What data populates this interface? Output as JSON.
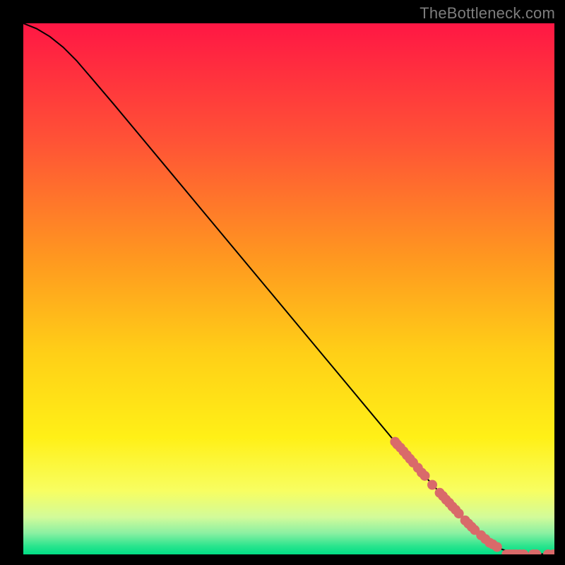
{
  "attribution": "TheBottleneck.com",
  "chart_data": {
    "type": "line",
    "title": "",
    "xlabel": "",
    "ylabel": "",
    "x_range": [
      0,
      1
    ],
    "y_range": [
      0,
      1
    ],
    "background_gradient": {
      "stops": [
        {
          "pos": 0.0,
          "color": "#FF1744"
        },
        {
          "pos": 0.22,
          "color": "#FF5236"
        },
        {
          "pos": 0.45,
          "color": "#FF9A1F"
        },
        {
          "pos": 0.62,
          "color": "#FFCF17"
        },
        {
          "pos": 0.78,
          "color": "#FFF017"
        },
        {
          "pos": 0.88,
          "color": "#F8FE61"
        },
        {
          "pos": 0.93,
          "color": "#D2FB9A"
        },
        {
          "pos": 0.96,
          "color": "#8AF0A2"
        },
        {
          "pos": 0.985,
          "color": "#28E48D"
        },
        {
          "pos": 1.0,
          "color": "#00DE85"
        }
      ]
    },
    "curve": {
      "points": [
        {
          "x": 0.0,
          "y": 1.0
        },
        {
          "x": 0.025,
          "y": 0.99
        },
        {
          "x": 0.05,
          "y": 0.975
        },
        {
          "x": 0.075,
          "y": 0.955
        },
        {
          "x": 0.1,
          "y": 0.93
        },
        {
          "x": 0.13,
          "y": 0.895
        },
        {
          "x": 0.17,
          "y": 0.848
        },
        {
          "x": 0.22,
          "y": 0.788
        },
        {
          "x": 0.28,
          "y": 0.716
        },
        {
          "x": 0.34,
          "y": 0.644
        },
        {
          "x": 0.4,
          "y": 0.572
        },
        {
          "x": 0.46,
          "y": 0.5
        },
        {
          "x": 0.52,
          "y": 0.428
        },
        {
          "x": 0.58,
          "y": 0.356
        },
        {
          "x": 0.64,
          "y": 0.284
        },
        {
          "x": 0.7,
          "y": 0.212
        },
        {
          "x": 0.76,
          "y": 0.143
        },
        {
          "x": 0.8,
          "y": 0.099
        },
        {
          "x": 0.83,
          "y": 0.067
        },
        {
          "x": 0.852,
          "y": 0.045
        },
        {
          "x": 0.87,
          "y": 0.029
        },
        {
          "x": 0.885,
          "y": 0.018
        },
        {
          "x": 0.9,
          "y": 0.01
        },
        {
          "x": 0.915,
          "y": 0.005
        },
        {
          "x": 0.935,
          "y": 0.002
        },
        {
          "x": 0.96,
          "y": 0.001
        },
        {
          "x": 1.0,
          "y": 0.0
        }
      ],
      "stroke": "#000000",
      "stroke_width": 2
    },
    "markers": {
      "color": "#D96A6A",
      "radius": 7,
      "points": [
        {
          "x": 0.7,
          "y": 0.212
        },
        {
          "x": 0.704,
          "y": 0.207
        },
        {
          "x": 0.71,
          "y": 0.201
        },
        {
          "x": 0.716,
          "y": 0.194
        },
        {
          "x": 0.722,
          "y": 0.187
        },
        {
          "x": 0.728,
          "y": 0.18
        },
        {
          "x": 0.734,
          "y": 0.173
        },
        {
          "x": 0.743,
          "y": 0.163
        },
        {
          "x": 0.75,
          "y": 0.154
        },
        {
          "x": 0.756,
          "y": 0.148
        },
        {
          "x": 0.77,
          "y": 0.131
        },
        {
          "x": 0.784,
          "y": 0.116
        },
        {
          "x": 0.79,
          "y": 0.11
        },
        {
          "x": 0.796,
          "y": 0.103
        },
        {
          "x": 0.802,
          "y": 0.097
        },
        {
          "x": 0.808,
          "y": 0.09
        },
        {
          "x": 0.814,
          "y": 0.084
        },
        {
          "x": 0.82,
          "y": 0.077
        },
        {
          "x": 0.832,
          "y": 0.064
        },
        {
          "x": 0.838,
          "y": 0.058
        },
        {
          "x": 0.844,
          "y": 0.052
        },
        {
          "x": 0.85,
          "y": 0.046
        },
        {
          "x": 0.862,
          "y": 0.036
        },
        {
          "x": 0.87,
          "y": 0.029
        },
        {
          "x": 0.878,
          "y": 0.022
        },
        {
          "x": 0.884,
          "y": 0.019
        },
        {
          "x": 0.892,
          "y": 0.014
        },
        {
          "x": 0.91,
          "y": 0.0
        },
        {
          "x": 0.916,
          "y": 0.0
        },
        {
          "x": 0.922,
          "y": 0.0
        },
        {
          "x": 0.928,
          "y": 0.0
        },
        {
          "x": 0.935,
          "y": 0.0
        },
        {
          "x": 0.942,
          "y": 0.0
        },
        {
          "x": 0.96,
          "y": 0.0
        },
        {
          "x": 0.966,
          "y": 0.0
        },
        {
          "x": 0.988,
          "y": 0.0
        },
        {
          "x": 0.998,
          "y": 0.0
        }
      ]
    }
  }
}
